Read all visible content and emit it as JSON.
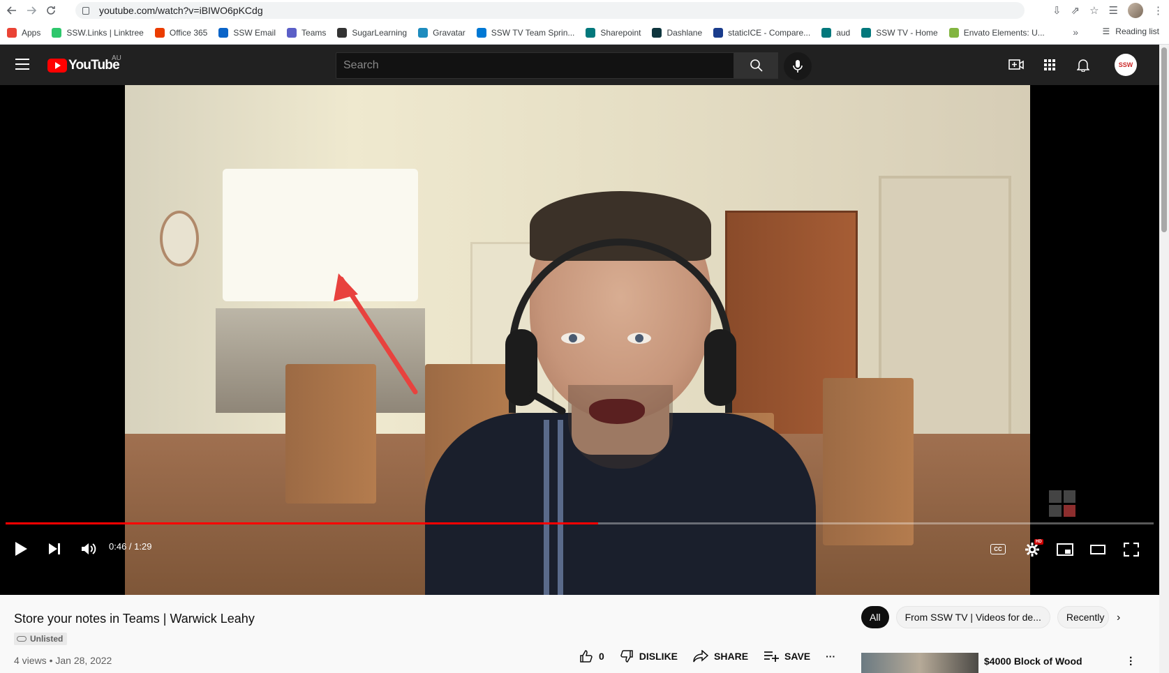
{
  "browser": {
    "url": "youtube.com/watch?v=iBIWO6pKCdg",
    "bookmarks": [
      {
        "label": "Apps",
        "color": "#ea4335"
      },
      {
        "label": "SSW.Links | Linktree",
        "color": "#2ec76c"
      },
      {
        "label": "Office 365",
        "color": "#eb3c00"
      },
      {
        "label": "SSW Email",
        "color": "#0a64c8"
      },
      {
        "label": "Teams",
        "color": "#5b5fc7"
      },
      {
        "label": "SugarLearning",
        "color": "#333333"
      },
      {
        "label": "Gravatar",
        "color": "#1e8cbe"
      },
      {
        "label": "SSW TV Team Sprin...",
        "color": "#0078d4"
      },
      {
        "label": "Sharepoint",
        "color": "#03787c"
      },
      {
        "label": "Dashlane",
        "color": "#0e353d"
      },
      {
        "label": "staticICE - Compare...",
        "color": "#1a3c8c"
      },
      {
        "label": "aud",
        "color": "#03787c"
      },
      {
        "label": "SSW TV - Home",
        "color": "#03787c"
      },
      {
        "label": "Envato Elements: U...",
        "color": "#82b540"
      }
    ],
    "more_label": "»",
    "reading_list": "Reading list"
  },
  "youtube": {
    "logo_text": "YouTube",
    "country": "AU",
    "search_placeholder": "Search",
    "channel_avatar_text": "SSW"
  },
  "player": {
    "time": "0:46 / 1:29",
    "progress": 0.516,
    "cc_label": "CC",
    "hd_label": "HD"
  },
  "video": {
    "title": "Store your notes in Teams | Warwick Leahy",
    "visibility": "Unlisted",
    "meta": "4 views • Jan 28, 2022",
    "likes": "0",
    "dislike_label": "DISLIKE",
    "share_label": "SHARE",
    "save_label": "SAVE",
    "more_label": "···"
  },
  "sidebar": {
    "chips": [
      "All",
      "From SSW TV | Videos for de...",
      "Recently"
    ],
    "recommendation_title": "$4000 Block of Wood"
  }
}
